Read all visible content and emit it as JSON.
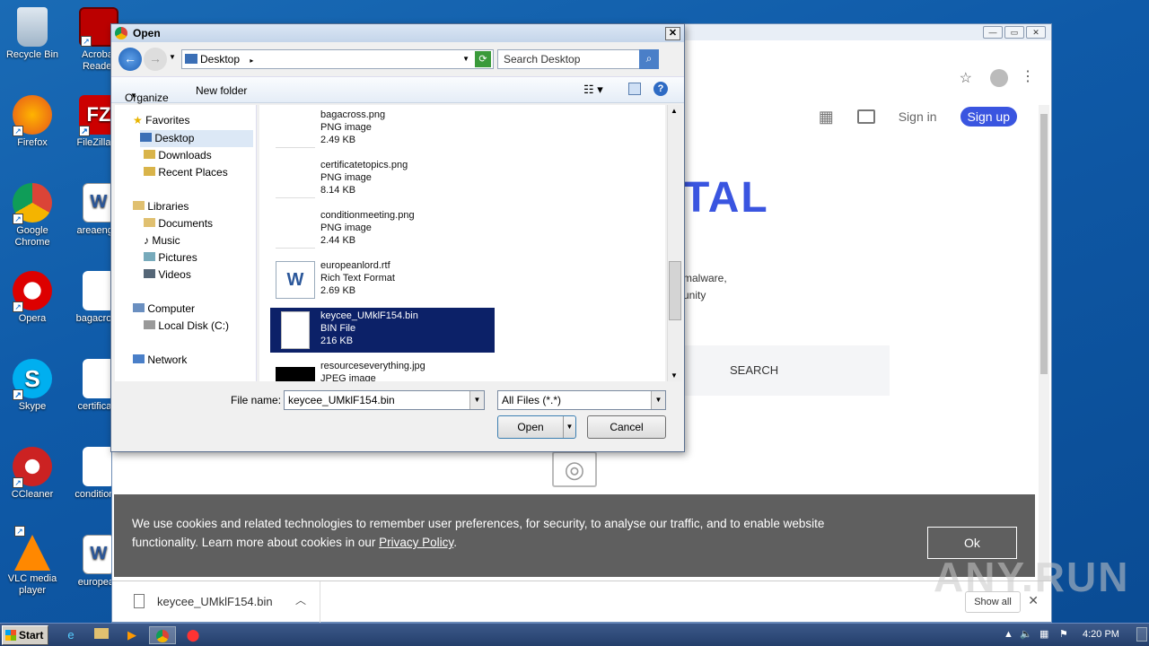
{
  "desktop": {
    "icons": [
      {
        "label": "Recycle Bin",
        "icon": "recycle-bin-icon"
      },
      {
        "label": "Acrobat Reader",
        "icon": "acrobat-icon"
      },
      {
        "label": "Firefox",
        "icon": "firefox-icon"
      },
      {
        "label": "FileZilla C",
        "icon": "filezilla-icon"
      },
      {
        "label": "Google Chrome",
        "icon": "chrome-icon"
      },
      {
        "label": "areaengla",
        "icon": "word-doc-icon"
      },
      {
        "label": "Opera",
        "icon": "opera-icon"
      },
      {
        "label": "bagacross",
        "icon": "image-file-icon"
      },
      {
        "label": "Skype",
        "icon": "skype-icon"
      },
      {
        "label": "certificate",
        "icon": "image-file-icon"
      },
      {
        "label": "CCleaner",
        "icon": "ccleaner-icon"
      },
      {
        "label": "conditionm",
        "icon": "image-file-icon"
      },
      {
        "label": "VLC media player",
        "icon": "vlc-icon"
      },
      {
        "label": "european",
        "icon": "word-doc-icon"
      }
    ]
  },
  "browser": {
    "nav": {
      "signin": "Sign in",
      "signup": "Sign up"
    },
    "hero_title": "TAL",
    "hero_desc": [
      "malware,",
      "unity"
    ],
    "search_tab": "SEARCH",
    "cookie": {
      "text_before": "We use cookies and related technologies to remember user preferences, for security, to analyse our traffic, and to enable website functionality. Learn more about cookies in our ",
      "link": "Privacy Policy",
      "text_after": ".",
      "ok": "Ok"
    },
    "download": {
      "filename": "keycee_UMklF154.bin",
      "show_all": "Show all"
    }
  },
  "dialog": {
    "title": "Open",
    "path": "Desktop",
    "search_placeholder": "Search Desktop",
    "toolbar": {
      "organize": "Organize",
      "new_folder": "New folder"
    },
    "nav": {
      "favorites": "Favorites",
      "desktop": "Desktop",
      "downloads": "Downloads",
      "recent": "Recent Places",
      "libraries": "Libraries",
      "documents": "Documents",
      "music": "Music",
      "pictures": "Pictures",
      "videos": "Videos",
      "computer": "Computer",
      "local_disk": "Local Disk (C:)",
      "network": "Network"
    },
    "files": [
      {
        "name": "bagacross.png",
        "type": "PNG image",
        "size": "2.49 KB"
      },
      {
        "name": "certificatetopics.png",
        "type": "PNG image",
        "size": "8.14 KB"
      },
      {
        "name": "conditionmeeting.png",
        "type": "PNG image",
        "size": "2.44 KB"
      },
      {
        "name": "europeanlord.rtf",
        "type": "Rich Text Format",
        "size": "2.69 KB"
      },
      {
        "name": "keycee_UMklF154.bin",
        "type": "BIN File",
        "size": "216 KB"
      },
      {
        "name": "resourceseverything.jpg",
        "type": "JPEG image",
        "size": ""
      }
    ],
    "file_name_label": "File name:",
    "file_name_value": "keycee_UMklF154.bin",
    "file_type_value": "All Files (*.*)",
    "open": "Open",
    "cancel": "Cancel"
  },
  "taskbar": {
    "start": "Start",
    "time": "4:20 PM"
  },
  "watermark": "ANY.RUN"
}
